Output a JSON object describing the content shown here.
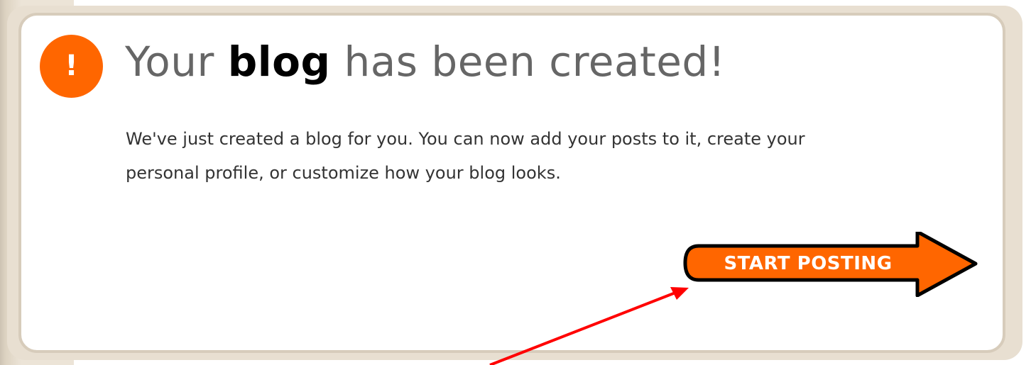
{
  "title": {
    "before": "Your ",
    "emphasis": "blog",
    "after": " has been created!"
  },
  "alert_icon": {
    "glyph": "!",
    "name": "exclamation-icon",
    "color": "#ff6600"
  },
  "message": {
    "line1": "We've just created a blog for you. You can now add your posts to it, create your",
    "line2": "personal profile, or customize how your blog looks."
  },
  "button": {
    "label": "START POSTING",
    "color": "#ff6600",
    "outline": "#000000",
    "icon": "arrow-right-icon"
  },
  "annotation": {
    "color": "#ff0000",
    "icon": "red-pointer-arrow"
  }
}
